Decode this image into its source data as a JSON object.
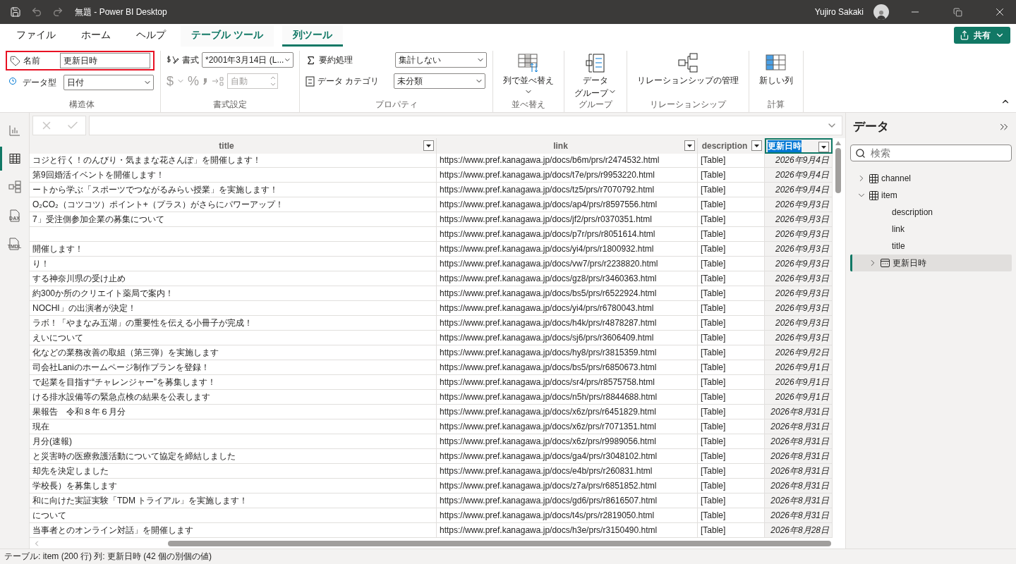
{
  "window": {
    "title": "無題 - Power BI Desktop",
    "user": "Yujiro Sakaki"
  },
  "ribbon_tabs": [
    {
      "label": "ファイル",
      "kind": "plain",
      "selected": false
    },
    {
      "label": "ホーム",
      "kind": "plain",
      "selected": false
    },
    {
      "label": "ヘルプ",
      "kind": "plain",
      "selected": false
    },
    {
      "label": "テーブル ツール",
      "kind": "contextual",
      "selected": false
    },
    {
      "label": "列ツール",
      "kind": "contextual",
      "selected": true
    }
  ],
  "share_button": {
    "label": "共有"
  },
  "structure": {
    "label": "構造体",
    "name_label": "名前",
    "name_value": "更新日時",
    "highlighted": true,
    "type_label": "データ型",
    "type_value": "日付"
  },
  "formatting": {
    "label": "書式設定",
    "format_label": "書式",
    "format_value": "*2001年3月14日 (L...",
    "currency_symbol": "$",
    "percent_symbol": "%",
    "decimals_value": "自動",
    "disabled": true
  },
  "properties": {
    "label": "プロパティ",
    "summary_label": "要約処理",
    "summary_value": "集計しない",
    "category_label": "データ カテゴリ",
    "category_value": "未分類"
  },
  "sort": {
    "label": "並べ替え",
    "button": "列で並べ替え"
  },
  "grouping": {
    "label": "グループ",
    "button_lines": [
      "データ",
      "グループ"
    ]
  },
  "relationships": {
    "label": "リレーションシップ",
    "button": "リレーションシップの管理"
  },
  "calculations": {
    "label": "計算",
    "button": "新しい列"
  },
  "rail": [
    {
      "kind": "report",
      "selected": false
    },
    {
      "kind": "table",
      "selected": true
    },
    {
      "kind": "model",
      "selected": false
    },
    {
      "kind": "file",
      "label": "DAX",
      "selected": false
    },
    {
      "kind": "file",
      "label": "TMDL",
      "selected": false
    }
  ],
  "table": {
    "columns": [
      {
        "label": "title",
        "selected": false
      },
      {
        "label": "link",
        "selected": false
      },
      {
        "label": "description",
        "selected": false
      },
      {
        "label": "更新日時",
        "selected": true
      }
    ],
    "rows": [
      {
        "title": "コジと行く！のんびり・気ままな花さんぽ」を開催します！",
        "link": "https://www.pref.kanagawa.jp/docs/b6m/prs/r2474532.html",
        "description": "[Table]",
        "date": "2026年9月4日"
      },
      {
        "title": "第9回婚活イベントを開催します！",
        "link": "https://www.pref.kanagawa.jp/docs/t7e/prs/r9953220.html",
        "description": "[Table]",
        "date": "2026年9月4日"
      },
      {
        "title": "ートから学ぶ「スポーツでつながるみらい授業」を実施します！",
        "link": "https://www.pref.kanagawa.jp/docs/tz5/prs/r7070792.html",
        "description": "[Table]",
        "date": "2026年9月4日"
      },
      {
        "title": "O₂CO₂（コツコツ）ポイント+（プラス）がさらにパワーアップ！",
        "link": "https://www.pref.kanagawa.jp/docs/ap4/prs/r8597556.html",
        "description": "[Table]",
        "date": "2026年9月3日"
      },
      {
        "title": "7」受注側参加企業の募集について",
        "link": "https://www.pref.kanagawa.jp/docs/jf2/prs/r0370351.html",
        "description": "[Table]",
        "date": "2026年9月3日"
      },
      {
        "link": "https://www.pref.kanagawa.jp/docs/p7r/prs/r8051614.html",
        "description": "[Table]",
        "date": "2026年9月3日"
      },
      {
        "title": "開催します！",
        "link": "https://www.pref.kanagawa.jp/docs/yi4/prs/r1800932.html",
        "description": "[Table]",
        "date": "2026年9月3日"
      },
      {
        "title": "り！",
        "link": "https://www.pref.kanagawa.jp/docs/vw7/prs/r2238820.html",
        "description": "[Table]",
        "date": "2026年9月3日"
      },
      {
        "title": "する神奈川県の受け止め",
        "link": "https://www.pref.kanagawa.jp/docs/gz8/prs/r3460363.html",
        "description": "[Table]",
        "date": "2026年9月3日"
      },
      {
        "title": "約300か所のクリエイト薬局で案内！",
        "link": "https://www.pref.kanagawa.jp/docs/bs5/prs/r6522924.html",
        "description": "[Table]",
        "date": "2026年9月3日"
      },
      {
        "title": "NOCHI」の出演者が決定！",
        "link": "https://www.pref.kanagawa.jp/docs/yi4/prs/r6780043.html",
        "description": "[Table]",
        "date": "2026年9月3日"
      },
      {
        "title": "ラボ！「やまなみ五湖」の重要性を伝える小冊子が完成！",
        "link": "https://www.pref.kanagawa.jp/docs/h4k/prs/r4878287.html",
        "description": "[Table]",
        "date": "2026年9月3日"
      },
      {
        "title": "えいについて",
        "link": "https://www.pref.kanagawa.jp/docs/sj6/prs/r3606409.html",
        "description": "[Table]",
        "date": "2026年9月3日"
      },
      {
        "title": "化などの業務改善の取組（第三弾）を実施します",
        "link": "https://www.pref.kanagawa.jp/docs/hy8/prs/r3815359.html",
        "description": "[Table]",
        "date": "2026年9月2日"
      },
      {
        "title": "司会社Laniのホームページ制作プランを登録！",
        "link": "https://www.pref.kanagawa.jp/docs/bs5/prs/r6850673.html",
        "description": "[Table]",
        "date": "2026年9月1日"
      },
      {
        "title": "で起業を目指す“チャレンジャー”を募集します！",
        "link": "https://www.pref.kanagawa.jp/docs/sr4/prs/r8575758.html",
        "description": "[Table]",
        "date": "2026年9月1日"
      },
      {
        "title": "ける排水設備等の緊急点検の結果を公表します",
        "link": "https://www.pref.kanagawa.jp/docs/n5h/prs/r8844688.html",
        "description": "[Table]",
        "date": "2026年9月1日"
      },
      {
        "title": "果報告　令和８年６月分",
        "link": "https://www.pref.kanagawa.jp/docs/x6z/prs/r6451829.html",
        "description": "[Table]",
        "date": "2026年8月31日"
      },
      {
        "title": "現在",
        "link": "https://www.pref.kanagawa.jp/docs/x6z/prs/r7071351.html",
        "description": "[Table]",
        "date": "2026年8月31日"
      },
      {
        "title": "月分(速報)",
        "link": "https://www.pref.kanagawa.jp/docs/x6z/prs/r9989056.html",
        "description": "[Table]",
        "date": "2026年8月31日"
      },
      {
        "title": "と災害時の医療救護活動について協定を締結しました",
        "link": "https://www.pref.kanagawa.jp/docs/ga4/prs/r3048102.html",
        "description": "[Table]",
        "date": "2026年8月31日"
      },
      {
        "title": "却先を決定しました",
        "link": "https://www.pref.kanagawa.jp/docs/e4b/prs/r260831.html",
        "description": "[Table]",
        "date": "2026年8月31日"
      },
      {
        "title": "学校長）を募集します",
        "link": "https://www.pref.kanagawa.jp/docs/z7a/prs/r6851852.html",
        "description": "[Table]",
        "date": "2026年8月31日"
      },
      {
        "title": "和に向けた実証実験「TDM トライアル」を実施します！",
        "link": "https://www.pref.kanagawa.jp/docs/gd6/prs/r8616507.html",
        "description": "[Table]",
        "date": "2026年8月31日"
      },
      {
        "title": "について",
        "link": "https://www.pref.kanagawa.jp/docs/t4s/prs/r2819050.html",
        "description": "[Table]",
        "date": "2026年8月31日"
      },
      {
        "title": "当事者とのオンライン対話」を開催します",
        "link": "https://www.pref.kanagawa.jp/docs/h3e/prs/r3150490.html",
        "description": "[Table]",
        "date": "2026年8月28日"
      }
    ]
  },
  "data_pane": {
    "title": "データ",
    "search": {
      "placeholder": "検索"
    },
    "tree": [
      {
        "label": "channel",
        "kind": "table",
        "expanded": false,
        "selected": false
      },
      {
        "label": "item",
        "kind": "table",
        "expanded": true,
        "selected": false,
        "children": [
          {
            "label": "description",
            "kind": "field",
            "selected": false
          },
          {
            "label": "link",
            "kind": "field",
            "selected": false
          },
          {
            "label": "title",
            "kind": "field",
            "selected": false
          },
          {
            "label": "更新日時",
            "kind": "date",
            "expanded": false,
            "selected": true
          }
        ]
      }
    ]
  },
  "status_bar": "テーブル: item (200 行) 列: 更新日時 (42 個の別個の値)"
}
